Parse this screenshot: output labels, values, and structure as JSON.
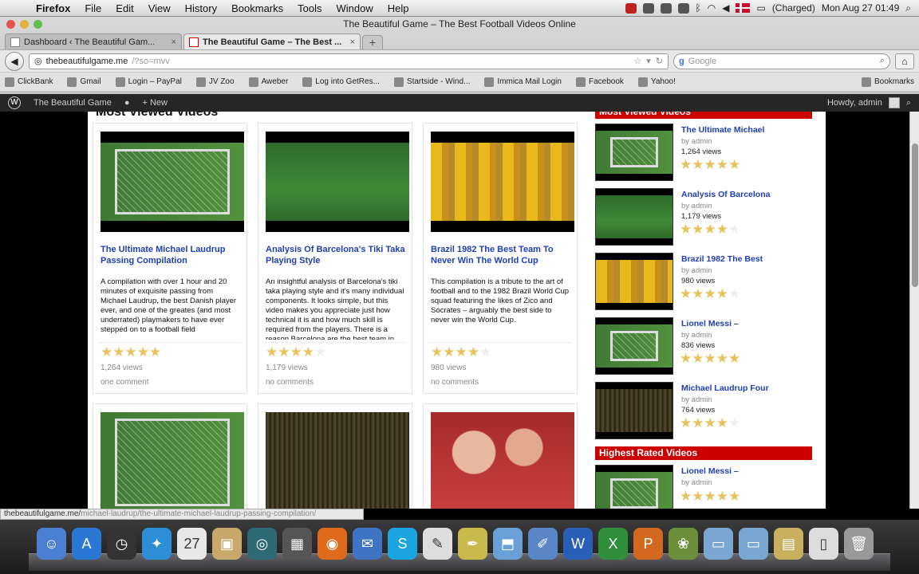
{
  "menubar": {
    "app": "Firefox",
    "items": [
      "File",
      "Edit",
      "View",
      "History",
      "Bookmarks",
      "Tools",
      "Window",
      "Help"
    ],
    "battery": "(Charged)",
    "clock": "Mon Aug 27  01:49"
  },
  "window": {
    "title": "The Beautiful Game – The Best Football Videos Online"
  },
  "tabs": [
    {
      "label": "Dashboard ‹ The Beautiful Gam..."
    },
    {
      "label": "The Beautiful Game – The Best ..."
    }
  ],
  "nav": {
    "url_host": "thebeautifulgame.me",
    "url_path": "/?so=mvv",
    "search_placeholder": "Google"
  },
  "bookmarks": [
    {
      "label": "ClickBank",
      "icon": "clickbank-icon"
    },
    {
      "label": "Gmail",
      "icon": "gmail-icon"
    },
    {
      "label": "Login – PayPal",
      "icon": "paypal-icon"
    },
    {
      "label": "JV Zoo",
      "icon": "jvzoo-icon"
    },
    {
      "label": "Aweber",
      "icon": "aweber-icon"
    },
    {
      "label": "Log into GetRes...",
      "icon": "getresponse-icon"
    },
    {
      "label": "Startside - Wind...",
      "icon": "star-icon"
    },
    {
      "label": "Immica Mail Login",
      "icon": "mail-icon"
    },
    {
      "label": "Facebook",
      "icon": "facebook-icon"
    },
    {
      "label": "Yahoo!",
      "icon": "yahoo-icon"
    }
  ],
  "bookmarks_menu": "Bookmarks",
  "wpbar": {
    "site": "The Beautiful Game",
    "new": "New",
    "howdy": "Howdy, admin"
  },
  "content": {
    "section_peek": "Most Viewed Videos",
    "cards": [
      {
        "title": "The Ultimate Michael Laudrup Passing Compilation",
        "excerpt": "A compilation with over 1 hour and 20 minutes of exquisite passing from Michael Laudrup, the best Danish player ever, and one of the greates (and most underrated) playmakers to have ever stepped on to a football field",
        "rating": 5,
        "views": "1,264 views",
        "comments": "one comment",
        "thumb": "goal"
      },
      {
        "title": "Analysis Of Barcelona's Tiki Taka Playing Style",
        "excerpt": "An insightful analysis of Barcelona's tiki taka playing style and it's many individual components. It looks simple, but this video makes you appreciate just how technical it is and how much skill is required from the players. There is a reason Barcelona are the best team in",
        "rating": 4,
        "views": "1,179 views",
        "comments": "no comments",
        "thumb": "pitch"
      },
      {
        "title": "Brazil 1982 The Best Team To Never Win The World Cup",
        "excerpt": "This compilation is a tribute to the art of football and to the 1982 Brazil World Cup squad featuring the likes of Zico and Socrates – arguably the best side to never win the World Cup.",
        "rating": 4,
        "views": "980 views",
        "comments": "no comments",
        "thumb": "yellow"
      }
    ],
    "row2_thumbs": [
      "goal",
      "crowd",
      "celebr"
    ],
    "sidebar": {
      "most_viewed_head": "Most Viewed Videos",
      "most_viewed": [
        {
          "title": "The Ultimate Michael",
          "by": "by admin",
          "views": "1,264 views",
          "rating": 5,
          "thumb": "goal"
        },
        {
          "title": "Analysis Of Barcelona",
          "by": "by admin",
          "views": "1,179 views",
          "rating": 4,
          "thumb": "pitch"
        },
        {
          "title": "Brazil 1982 The Best",
          "by": "by admin",
          "views": "980 views",
          "rating": 4,
          "thumb": "yellow"
        },
        {
          "title": "Lionel Messi –",
          "by": "by admin",
          "views": "836 views",
          "rating": 5,
          "thumb": "goal"
        },
        {
          "title": "Michael Laudrup Four",
          "by": "by admin",
          "views": "764 views",
          "rating": 4,
          "thumb": "crowd"
        }
      ],
      "highest_rated_head": "Highest Rated Videos",
      "highest_rated": [
        {
          "title": "Lionel Messi –",
          "by": "by admin",
          "views": "",
          "rating": 5,
          "thumb": "goal"
        }
      ]
    }
  },
  "statusbar": {
    "host": "thebeautifulgame.me/",
    "path": "michael-laudrup/the-ultimate-michael-laudrup-passing-compilation/"
  },
  "dock": [
    {
      "name": "finder-icon",
      "glyph": "☺",
      "color": "#4a7fd1"
    },
    {
      "name": "app-store-icon",
      "glyph": "A",
      "color": "#2a78d4"
    },
    {
      "name": "dashboard-icon",
      "glyph": "◷",
      "color": "#333"
    },
    {
      "name": "safari-icon",
      "glyph": "✦",
      "color": "#2c8fd6"
    },
    {
      "name": "calendar-icon",
      "glyph": "27",
      "color": "#e8e8e8"
    },
    {
      "name": "photo-icon",
      "glyph": "▣",
      "color": "#c9a96b"
    },
    {
      "name": "time-machine-icon",
      "glyph": "◎",
      "color": "#2d6a74"
    },
    {
      "name": "screenshot-icon",
      "glyph": "▦",
      "color": "#555"
    },
    {
      "name": "firefox-icon",
      "glyph": "◉",
      "color": "#e06a1b"
    },
    {
      "name": "mail-stamp-icon",
      "glyph": "✉",
      "color": "#3f74c4"
    },
    {
      "name": "skype-icon",
      "glyph": "S",
      "color": "#1aa4e0"
    },
    {
      "name": "textedit-icon",
      "glyph": "✎",
      "color": "#ddd"
    },
    {
      "name": "pen-icon",
      "glyph": "✒",
      "color": "#c9b84a"
    },
    {
      "name": "preview-icon",
      "glyph": "⬒",
      "color": "#6aa0d8"
    },
    {
      "name": "editor-icon",
      "glyph": "✐",
      "color": "#5a86c8"
    },
    {
      "name": "word-icon",
      "glyph": "W",
      "color": "#2a5fb8"
    },
    {
      "name": "excel-icon",
      "glyph": "X",
      "color": "#2f8f3a"
    },
    {
      "name": "powerpoint-icon",
      "glyph": "P",
      "color": "#d2691e"
    },
    {
      "name": "photos-icon",
      "glyph": "❀",
      "color": "#6b8f3a"
    },
    {
      "name": "folder-icon",
      "glyph": "▭",
      "color": "#7aa6d2"
    },
    {
      "name": "folder-icon-2",
      "glyph": "▭",
      "color": "#7aa6d2"
    },
    {
      "name": "archive-icon",
      "glyph": "▤",
      "color": "#c8b060"
    },
    {
      "name": "document-icon",
      "glyph": "▯",
      "color": "#ddd"
    },
    {
      "name": "trash-icon",
      "glyph": "🗑",
      "color": "#999"
    }
  ]
}
